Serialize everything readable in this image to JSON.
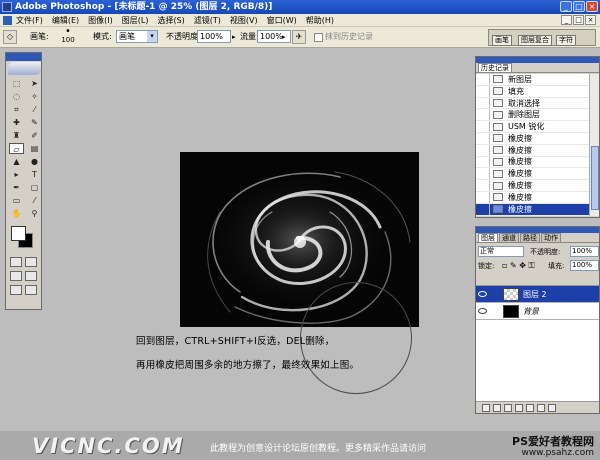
{
  "window": {
    "title": "Adobe Photoshop - [未标题-1 @ 25% (图层 2, RGB/8)]",
    "buttons": [
      "_",
      "□",
      "×"
    ]
  },
  "menubar": {
    "items": [
      "文件(F)",
      "编辑(E)",
      "图像(I)",
      "图层(L)",
      "选择(S)",
      "滤镜(T)",
      "视图(V)",
      "窗口(W)",
      "帮助(H)"
    ],
    "doc_buttons": [
      "_",
      "□",
      "×"
    ]
  },
  "options": {
    "brush_label": "画笔:",
    "brush_size": "100",
    "mode_label": "模式:",
    "mode_value": "画笔",
    "opacity_label": "不透明度:",
    "opacity_value": "100%",
    "flow_label": "流量:",
    "flow_value": "100%",
    "history_erase_label": "抹到历史记录",
    "well_tabs": [
      "画笔",
      "图层复合",
      "字符"
    ]
  },
  "history_panel": {
    "tab": "历史记录",
    "items": [
      {
        "label": "新图层",
        "active": false
      },
      {
        "label": "填充",
        "active": false
      },
      {
        "label": "取消选择",
        "active": false
      },
      {
        "label": "删除图层",
        "active": false
      },
      {
        "label": "USM 锐化",
        "active": false
      },
      {
        "label": "橡皮擦",
        "active": false
      },
      {
        "label": "橡皮擦",
        "active": false
      },
      {
        "label": "橡皮擦",
        "active": false
      },
      {
        "label": "橡皮擦",
        "active": false
      },
      {
        "label": "橡皮擦",
        "active": false
      },
      {
        "label": "橡皮擦",
        "active": false
      },
      {
        "label": "橡皮擦",
        "active": true
      }
    ]
  },
  "layers_panel": {
    "tabs": [
      "图层",
      "通道",
      "路径",
      "动作"
    ],
    "blend_mode": "正常",
    "opacity_label": "不透明度:",
    "opacity_value": "100%",
    "lock_label": "锁定:",
    "fill_label": "填充:",
    "fill_value": "100%",
    "layers": [
      {
        "name": "图层 2",
        "active": true,
        "thumb": "transparent"
      },
      {
        "name": "背景",
        "active": false,
        "thumb": "black"
      }
    ]
  },
  "caption": {
    "line1": "回到图层，CTRL+SHIFT+I反选，DEL删除，",
    "line2": "再用橡皮把周围多余的地方擦了，最终效果如上图。"
  },
  "footer": {
    "logo": "VICNC.COM",
    "text": "此教程为创意设计论坛原创教程。更多精采作品请访问",
    "brand": "PS爱好者教程网",
    "url": "www.psahz.com"
  }
}
